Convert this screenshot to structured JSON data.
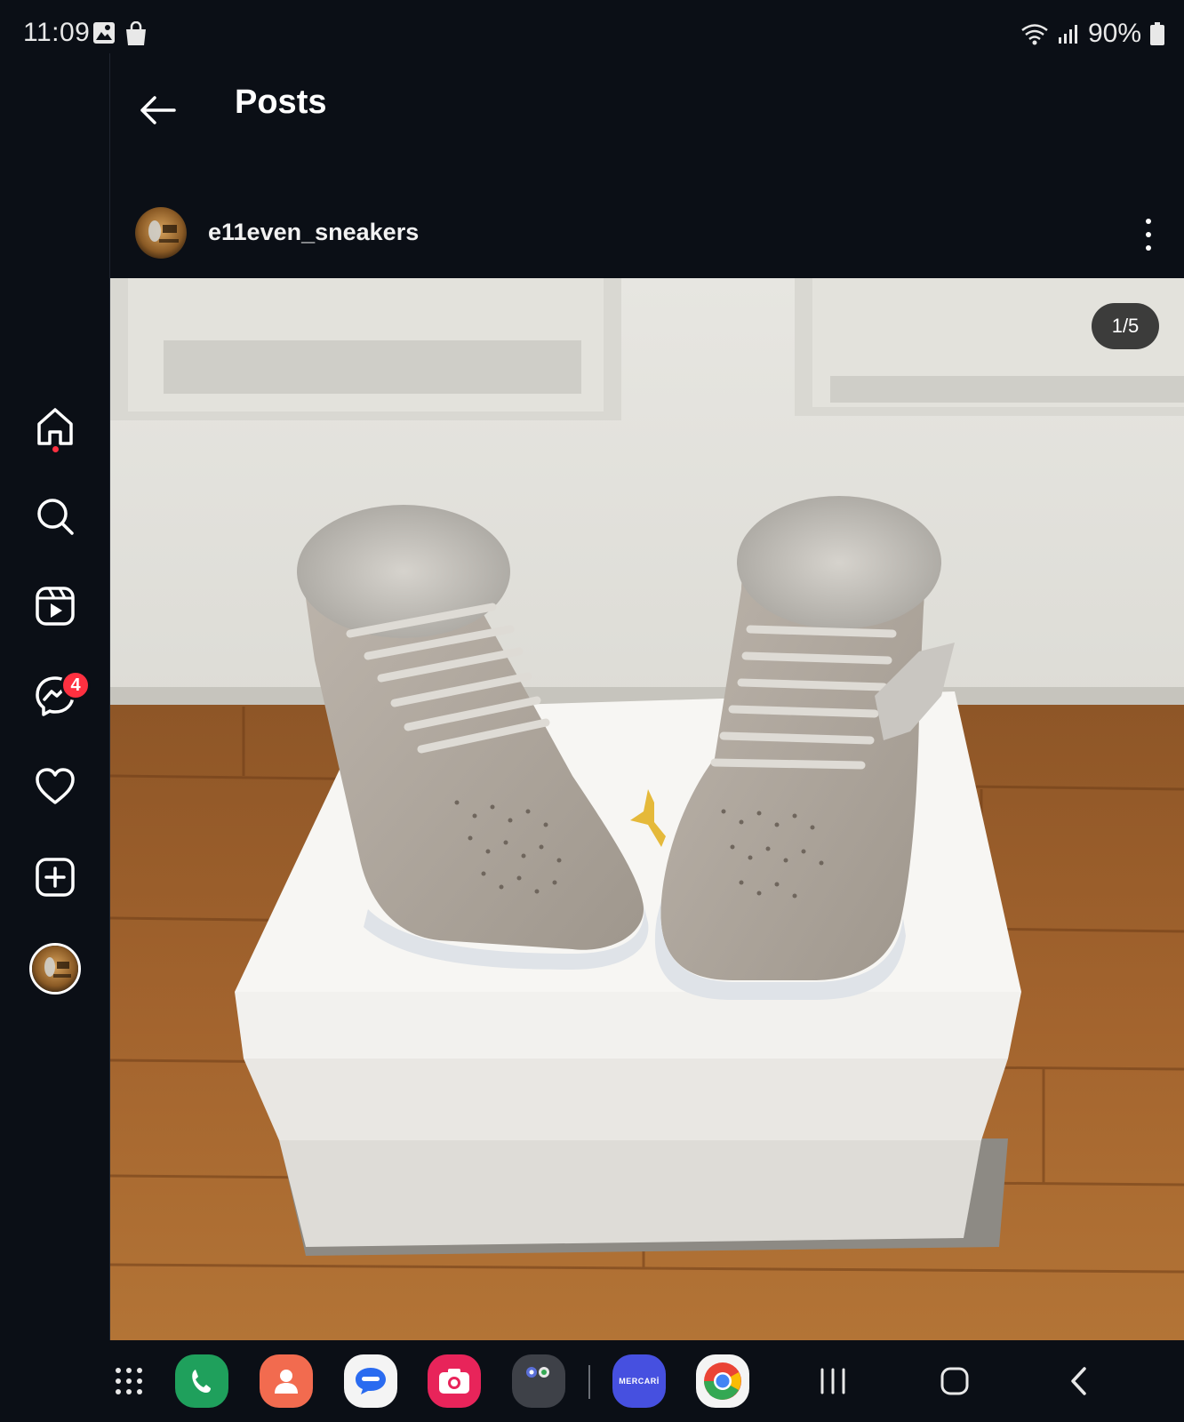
{
  "status_bar": {
    "time": "11:09",
    "battery": "90%",
    "icons": [
      "gallery-icon",
      "shopping-bag-icon",
      "wifi-icon",
      "signal-icon",
      "battery-icon"
    ]
  },
  "header": {
    "title": "Posts"
  },
  "nav": {
    "items": [
      "home-icon",
      "search-icon",
      "reels-icon",
      "messenger-icon",
      "heart-icon",
      "create-icon",
      "profile-avatar"
    ],
    "messages_badge": "4"
  },
  "post": {
    "username": "e11even_sneakers",
    "counter": "1/5"
  },
  "dock": {
    "apps": [
      "apps-grid-icon",
      "phone-app",
      "contacts-app",
      "messages-app",
      "camera-app",
      "app-folder",
      "mercari-app",
      "chrome-app"
    ],
    "mercari_label": "MERCARİ",
    "system": [
      "recents-button",
      "home-button",
      "back-button"
    ]
  },
  "colors": {
    "background": "#0b0f16",
    "badge": "#ff3040",
    "floor": "#9a5a2a",
    "wall": "#ecebe6"
  }
}
